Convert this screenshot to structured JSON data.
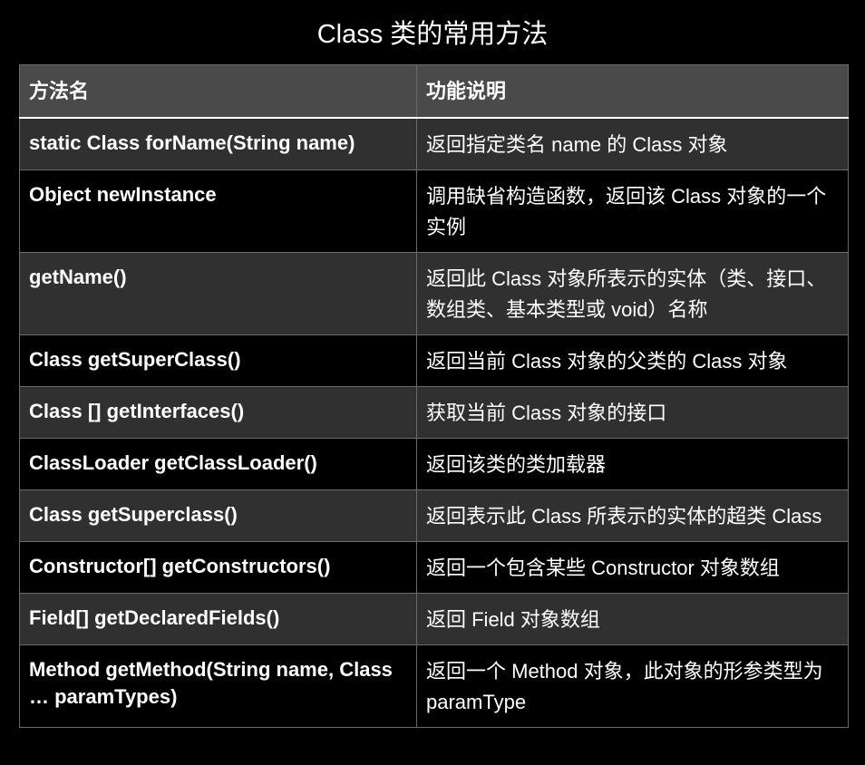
{
  "title": "Class 类的常用方法",
  "table": {
    "headers": [
      "方法名",
      "功能说明"
    ],
    "rows": [
      {
        "method": "static Class forName(String name)",
        "description": "返回指定类名 name 的 Class 对象"
      },
      {
        "method": "Object newInstance",
        "description": "调用缺省构造函数，返回该 Class 对象的一个实例"
      },
      {
        "method": "getName()",
        "description": "返回此 Class 对象所表示的实体（类、接口、数组类、基本类型或 void）名称"
      },
      {
        "method": "Class getSuperClass()",
        "description": "返回当前 Class 对象的父类的 Class 对象"
      },
      {
        "method": "Class [] getInterfaces()",
        "description": "获取当前 Class 对象的接口"
      },
      {
        "method": "ClassLoader getClassLoader()",
        "description": "返回该类的类加载器"
      },
      {
        "method": "Class getSuperclass()",
        "description": "返回表示此 Class 所表示的实体的超类 Class"
      },
      {
        "method": "Constructor[] getConstructors()",
        "description": "返回一个包含某些 Constructor 对象数组"
      },
      {
        "method": "Field[] getDeclaredFields()",
        "description": "返回 Field 对象数组"
      },
      {
        "method": "Method getMethod(String name, Class … paramTypes)",
        "description": "返回一个 Method 对象，此对象的形参类型为 paramType"
      }
    ]
  }
}
